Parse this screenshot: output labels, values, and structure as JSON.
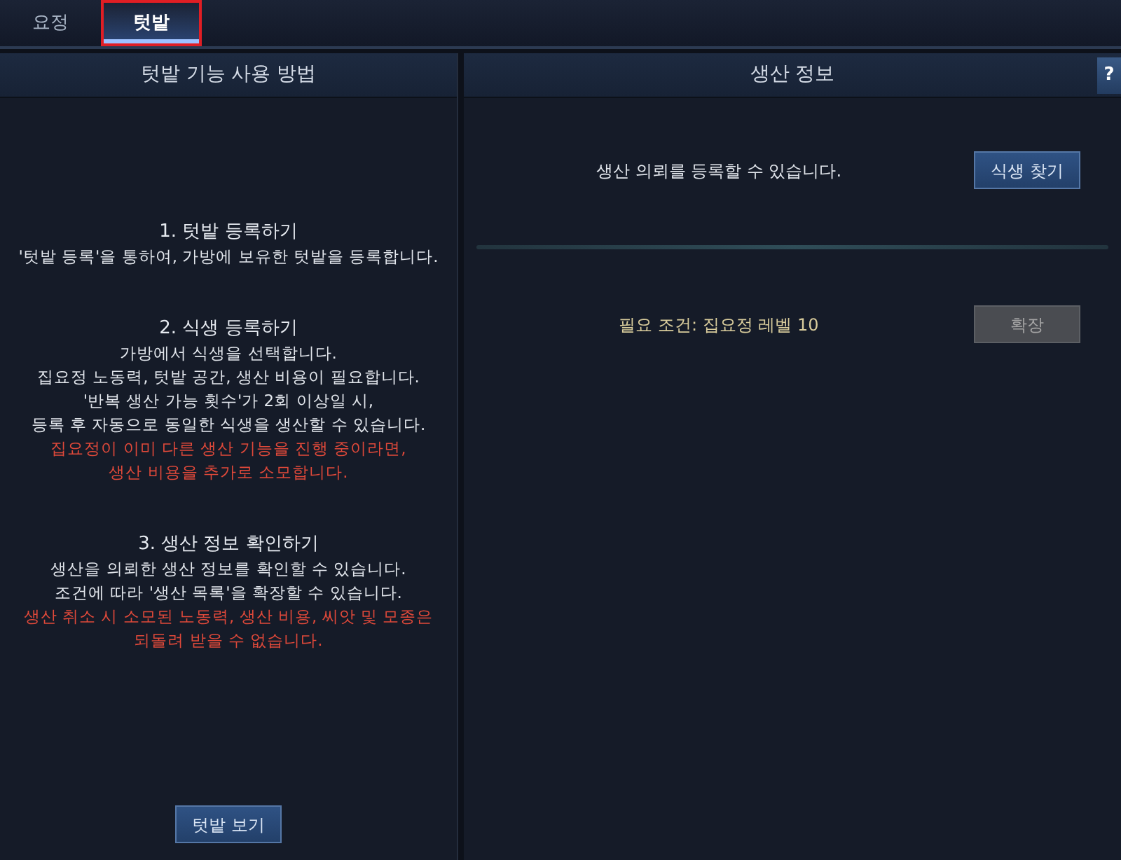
{
  "tabs": [
    {
      "label": "요정",
      "selected": false,
      "highlighted": false
    },
    {
      "label": "텃밭",
      "selected": true,
      "highlighted": true
    }
  ],
  "guide_panel": {
    "title": "텃밭 기능 사용 방법",
    "sections": [
      {
        "title": "1. 텃밭 등록하기",
        "paragraphs": [
          {
            "kind": "note",
            "lines": [
              "'텃밭 등록'을 통하여, 가방에 보유한 텃밭을 등록합니다."
            ]
          }
        ]
      },
      {
        "title": "2. 식생 등록하기",
        "paragraphs": [
          {
            "kind": "note",
            "lines": [
              "가방에서 식생을 선택합니다.",
              "집요정 노동력, 텃밭 공간, 생산 비용이 필요합니다.",
              "'반복 생산 가능 횟수'가 2회 이상일 시,",
              "등록 후 자동으로 동일한 식생을 생산할 수 있습니다."
            ]
          },
          {
            "kind": "warning",
            "lines": [
              "집요정이 이미 다른 생산 기능을 진행 중이라면,",
              "생산 비용을 추가로 소모합니다."
            ]
          }
        ]
      },
      {
        "title": "3. 생산 정보 확인하기",
        "paragraphs": [
          {
            "kind": "note",
            "lines": [
              "생산을 의뢰한 생산 정보를 확인할 수 있습니다.",
              "조건에 따라 '생산 목록'을 확장할 수 있습니다."
            ]
          },
          {
            "kind": "warning",
            "lines": [
              "생산 취소 시 소모된 노동력, 생산 비용, 씨앗 및 모종은",
              "되돌려 받을 수 없습니다."
            ]
          }
        ]
      }
    ],
    "button": {
      "label": "텃밭 보기",
      "disabled": false
    }
  },
  "production_panel": {
    "title": "생산 정보",
    "help_button": "?",
    "rows": [
      {
        "kind": "info",
        "text": "생산 의뢰를 등록할 수 있습니다.",
        "button": {
          "label": "식생 찾기",
          "disabled": false
        }
      },
      {
        "kind": "requirement",
        "text": "필요 조건: 집요정 레벨 10",
        "button": {
          "label": "확장",
          "disabled": true
        }
      }
    ]
  }
}
